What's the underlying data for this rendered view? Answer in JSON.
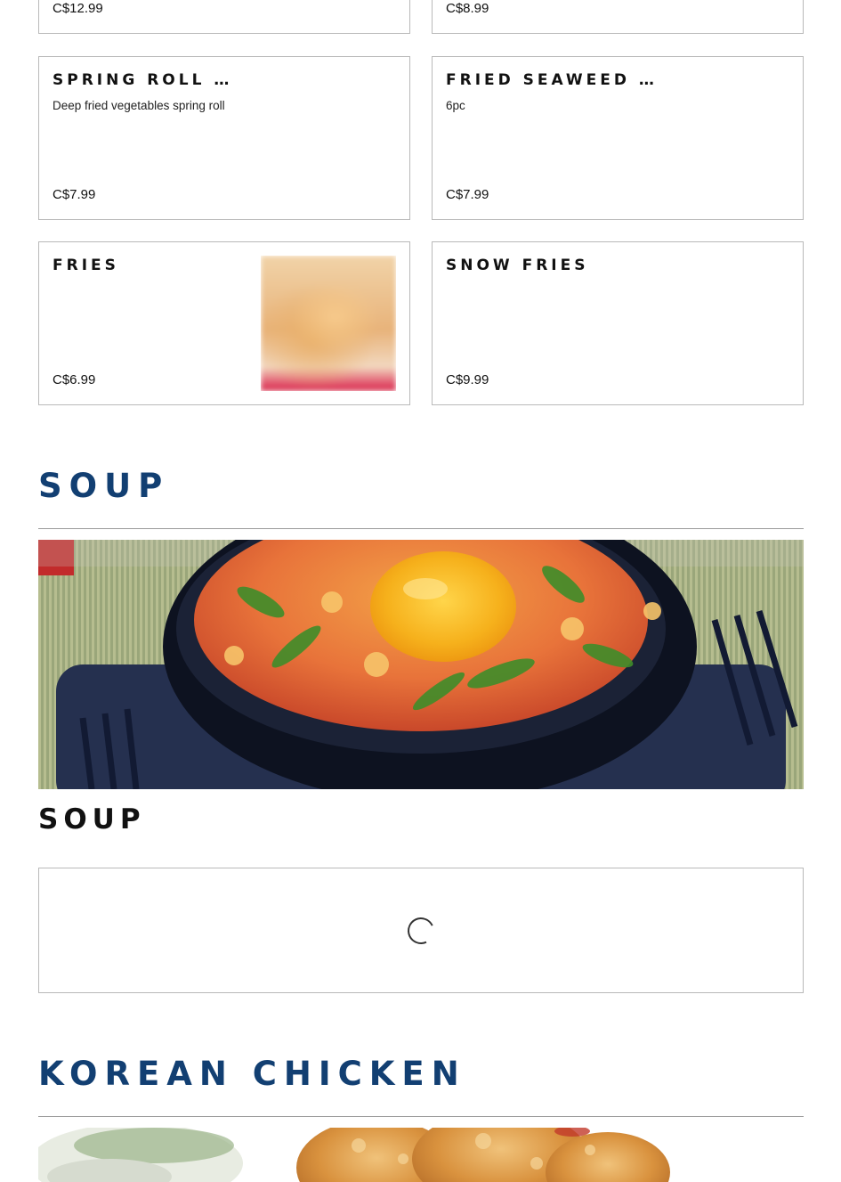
{
  "top_row": [
    {
      "price": "C$12.99"
    },
    {
      "price": "C$8.99"
    }
  ],
  "items": [
    {
      "name": "SPRING ROLL …",
      "description": "Deep fried vegetables spring roll",
      "price": "C$7.99"
    },
    {
      "name": "FRIED SEAWEED …",
      "description": "6pc",
      "price": "C$7.99"
    },
    {
      "name": "FRIES",
      "description": "",
      "price": "C$6.99"
    },
    {
      "name": "SNOW FRIES",
      "description": "",
      "price": "C$9.99"
    }
  ],
  "sections": {
    "soup": {
      "title": "SOUP",
      "subtitle": "SOUP"
    },
    "korean_chicken": {
      "title": "KOREAN CHICKEN"
    }
  },
  "colors": {
    "section_title": "#123f72",
    "card_border": "#b9b9b9",
    "text": "#111111"
  },
  "icons": {
    "loader": "loading-spinner-icon"
  }
}
